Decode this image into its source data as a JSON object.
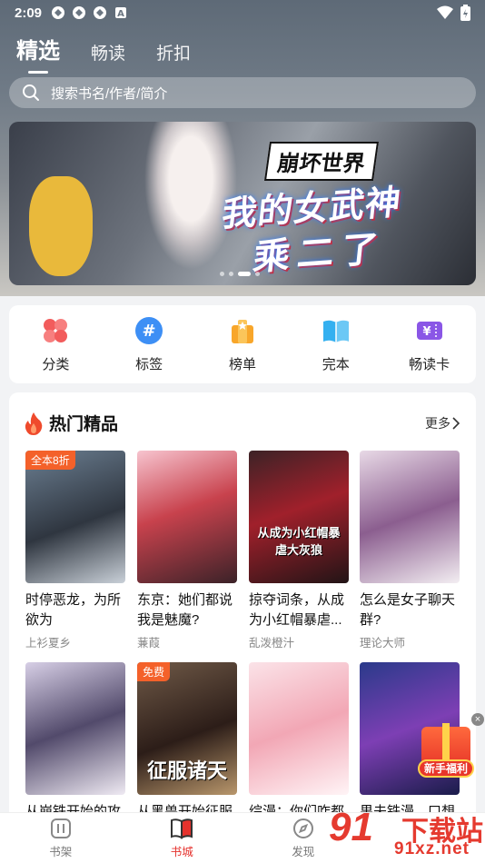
{
  "status_bar": {
    "time": "2:09"
  },
  "top_tabs": [
    {
      "label": "精选",
      "active": true
    },
    {
      "label": "畅读",
      "active": false
    },
    {
      "label": "折扣",
      "active": false
    }
  ],
  "search": {
    "placeholder": "搜索书名/作者/简介"
  },
  "banner": {
    "title_small": "崩坏世界",
    "title_line1": "我的女武神",
    "title_line2": "乘二了"
  },
  "categories": [
    {
      "label": "分类",
      "icon": "clover-icon",
      "color": "#f25c5c"
    },
    {
      "label": "标签",
      "icon": "hashtag-icon",
      "color": "#3d8ff5"
    },
    {
      "label": "榜单",
      "icon": "trophy-icon",
      "color": "#f8a62a"
    },
    {
      "label": "完本",
      "icon": "open-book-icon",
      "color": "#34b0f0"
    },
    {
      "label": "畅读卡",
      "icon": "ticket-icon",
      "color": "#8a56e6"
    }
  ],
  "hot_section": {
    "title": "热门精品",
    "more_label": "更多"
  },
  "books_row1": [
    {
      "title": "时停恶龙，为所欲为",
      "author": "上衫夏乡",
      "badge": "全本8折",
      "cover_text": ""
    },
    {
      "title": "东京：她们都说我是魅魔?",
      "author": "蒹葭",
      "badge": "",
      "cover_text": ""
    },
    {
      "title": "掠夺词条，从成为小红帽暴虐...",
      "author": "乱泼橙汁",
      "badge": "",
      "cover_text": "从成为小红帽暴虐大灰狼"
    },
    {
      "title": "怎么是女子聊天群?",
      "author": "理论大师",
      "badge": "",
      "cover_text": ""
    }
  ],
  "books_row2": [
    {
      "title": "从崩铁开始的攻",
      "badge": "",
      "cover_text": ""
    },
    {
      "title": "从黑兽开始征服",
      "badge": "免费",
      "cover_text": "征服诸天"
    },
    {
      "title": "综漫：你们咋都",
      "badge": "",
      "cover_text": ""
    },
    {
      "title": "果夫铁漫，口想",
      "badge": "",
      "cover_text": ""
    }
  ],
  "gift": {
    "label": "新手福利"
  },
  "bottom_nav": [
    {
      "label": "书架",
      "active": false
    },
    {
      "label": "书城",
      "active": true
    },
    {
      "label": "发现",
      "active": false
    },
    {
      "label": "",
      "active": false
    }
  ],
  "watermark": {
    "number": "91",
    "text": "下载站",
    "url": "91xz.net"
  }
}
